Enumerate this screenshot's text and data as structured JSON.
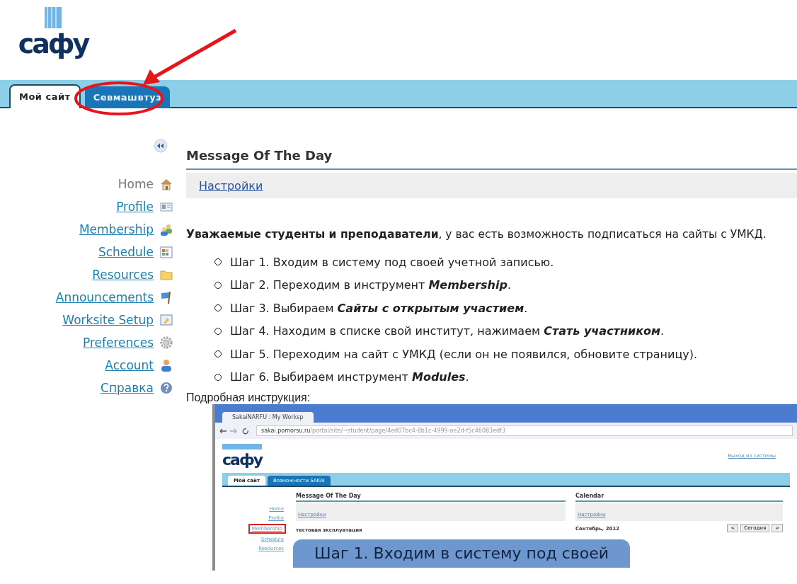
{
  "logo": {
    "text": "сафу"
  },
  "tabs": [
    {
      "label": "Мой сайт",
      "selected": true
    },
    {
      "label": "Севмашвтуз",
      "selected": false
    }
  ],
  "sidebar": {
    "items": [
      {
        "label": "Home",
        "kind": "home",
        "current": true
      },
      {
        "label": "Profile",
        "kind": "profile",
        "current": false
      },
      {
        "label": "Membership",
        "kind": "membership",
        "current": false
      },
      {
        "label": "Schedule",
        "kind": "schedule",
        "current": false
      },
      {
        "label": "Resources",
        "kind": "resources",
        "current": false
      },
      {
        "label": "Announcements",
        "kind": "announcements",
        "current": false
      },
      {
        "label": "Worksite Setup",
        "kind": "setup",
        "current": false
      },
      {
        "label": "Preferences",
        "kind": "preferences",
        "current": false
      },
      {
        "label": "Account",
        "kind": "account",
        "current": false
      },
      {
        "label": "Справка",
        "kind": "help",
        "current": false
      }
    ]
  },
  "content": {
    "title": "Message Of The Day",
    "settings_link": "Настройки",
    "intro": "**Уважаемые студенты и преподаватели**, у вас есть возможность подписаться на сайты с УМКД.",
    "steps": [
      "Шаг 1. Входим в систему под своей учетной записью.",
      "Шаг 2. Переходим в инструмент *Membership*.",
      "Шаг 3. Выбираем  *Сайты с открытым участием*.",
      "Шаг 4. Находим в списке свой институт, нажимаем *Стать участником*.",
      "Шаг 5. Переходим на сайт с УМКД (если он не появился,  обновите страницу).",
      "Шаг 6. Выбираем инструмент *Modules*."
    ],
    "instruction_label": "Подробная инструкция:"
  },
  "screenshot": {
    "browser_tab": "SakaiNARFU : My Worksp",
    "url_host": "sakai.pomorsu.ru",
    "url_path": "/portal/site/~student/page/4ed07bc4-8b1c-4999-ae2d-f5c46083edf3",
    "logout": "Выход из системы",
    "logo": "сафу",
    "tabs": [
      {
        "label": "Мой сайт",
        "selected": true
      },
      {
        "label": "Возможности SAKAI",
        "selected": false
      }
    ],
    "sidebar": [
      {
        "label": "Home",
        "highlighted": false
      },
      {
        "label": "Profile",
        "highlighted": false
      },
      {
        "label": "Membership",
        "highlighted": true
      },
      {
        "label": "Schedule",
        "highlighted": false
      },
      {
        "label": "Resources",
        "highlighted": false
      }
    ],
    "motd_title": "Message Of The Day",
    "motd_settings": "Настройки",
    "motd_text": "тестовая эксплуатация",
    "calendar_title": "Calendar",
    "calendar_settings": "Настройки",
    "calendar_month": "Сентябрь, 2012",
    "calendar_buttons": [
      "<",
      "Сегодня",
      ">"
    ],
    "callout": "Шаг 1. Входим в систему под своей"
  }
}
